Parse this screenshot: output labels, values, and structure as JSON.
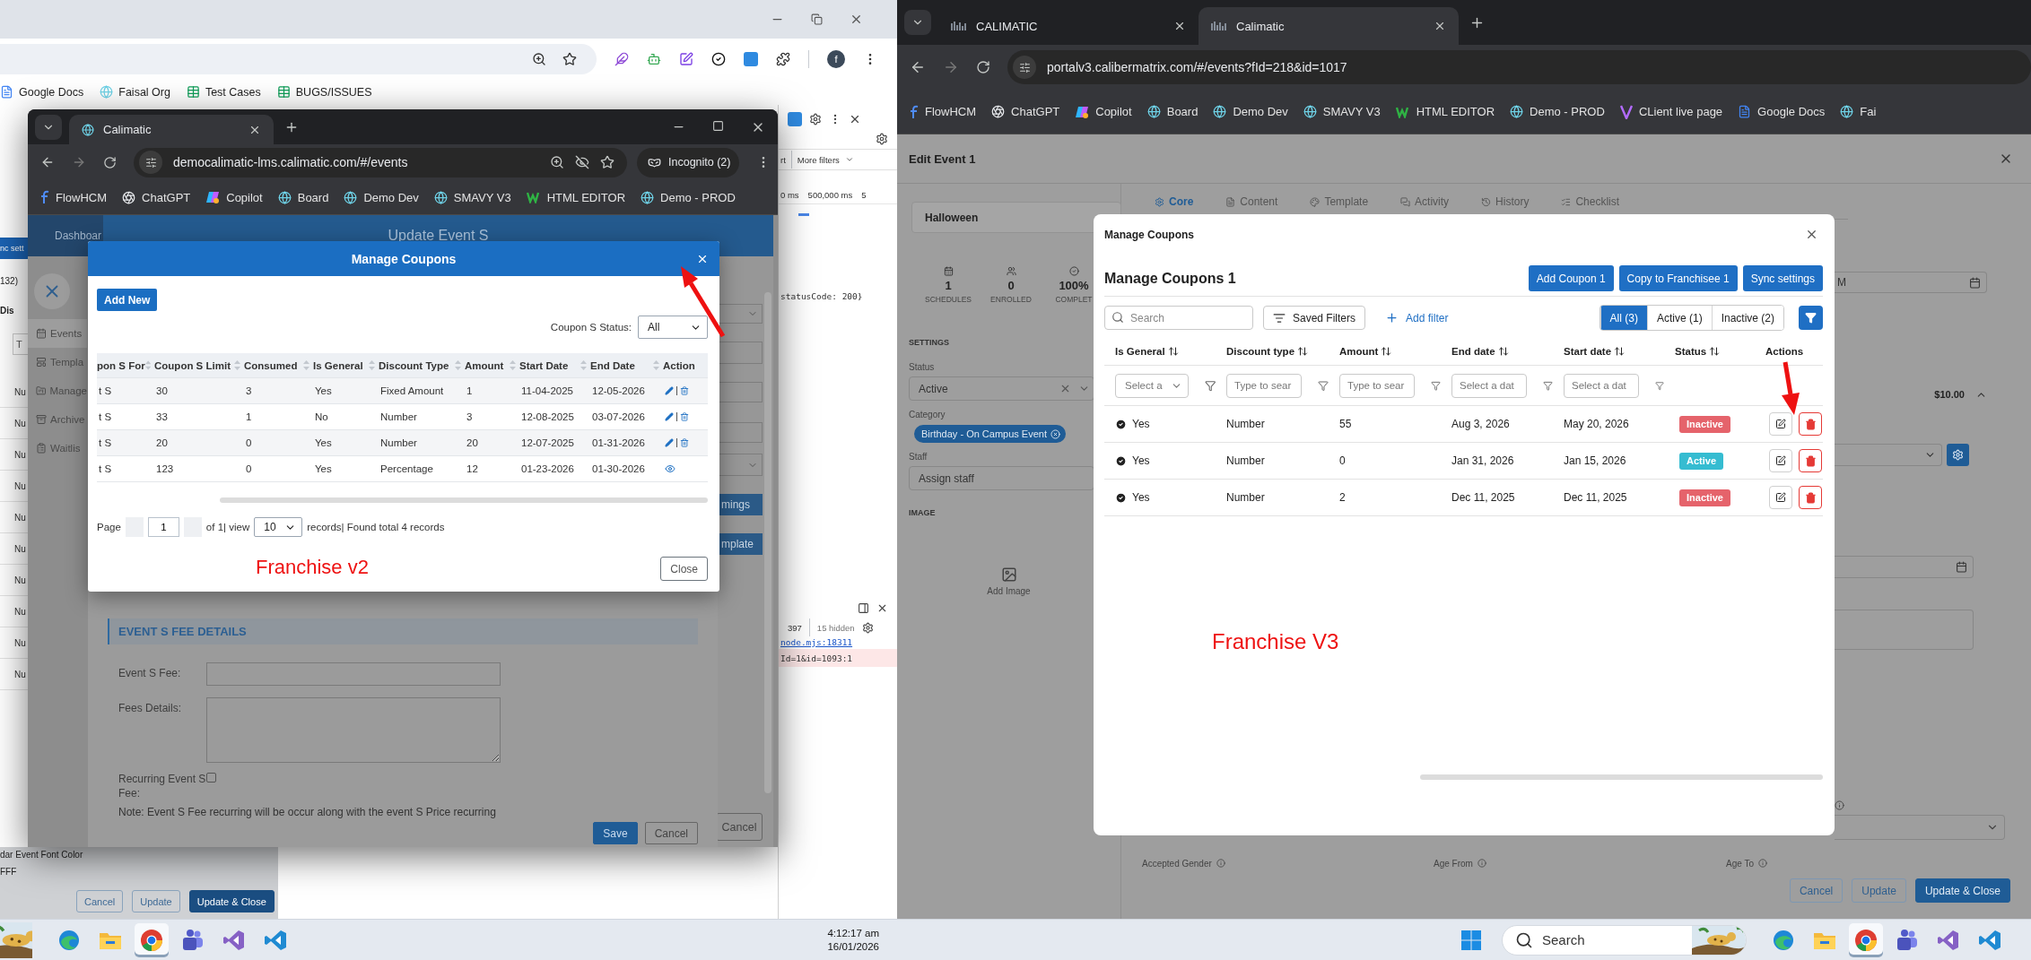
{
  "back_window": {
    "profile": "f",
    "bookmarks": [
      {
        "label": "Google Docs"
      },
      {
        "label": "Faisal Org"
      },
      {
        "label": "Test Cases"
      },
      {
        "label": "BUGS/ISSUES"
      }
    ],
    "page": {
      "sync_button": "nc sett",
      "count": "132)",
      "column": "Dis",
      "field_placeholder": "T",
      "cells": [
        "Nu",
        "Nu",
        "Nu",
        "Nu",
        "Nu",
        "Nu",
        "Nu",
        "Nu",
        "Nu",
        "Nu"
      ],
      "color_label": "dar Event Font Color",
      "color_value": "FFF",
      "buttons": [
        "Cancel",
        "Update",
        "Update & Close"
      ]
    },
    "devtools": {
      "tab": "rt",
      "filter": "More filters",
      "timeline": [
        "0 ms",
        "500,000 ms",
        "5"
      ],
      "console_line": "statusCode: 200}",
      "issue_count": "397",
      "hidden": "15 hidden",
      "source_link": "node.mjs:18311",
      "error_line": "Id=1&id=1093:1"
    }
  },
  "incognito_window": {
    "tab": "Calimatic",
    "url": "democalimatic-lms.calimatic.com/#/events",
    "incognito": "Incognito (2)",
    "bookmarks": [
      {
        "label": "FlowHCM"
      },
      {
        "label": "ChatGPT"
      },
      {
        "label": "Copilot"
      },
      {
        "label": "Board"
      },
      {
        "label": "Demo Dev"
      },
      {
        "label": "SMAVY V3"
      },
      {
        "label": "HTML EDITOR"
      },
      {
        "label": "Demo - PROD"
      }
    ],
    "page": {
      "nav": "Dashboar",
      "title": "Update Event S",
      "sidebar": [
        {
          "label": "Events",
          "selected": true
        },
        {
          "label": "Templa",
          "selected": false
        },
        {
          "label": "Manage",
          "selected": false
        },
        {
          "label": "Archive",
          "selected": false
        },
        {
          "label": "Waitlis",
          "selected": false
        }
      ],
      "side_buttons": [
        "mings",
        "mplate"
      ],
      "outer_cancel": "Cancel",
      "fee_section": {
        "title": "EVENT S FEE DETAILS",
        "fee_label": "Event S Fee:",
        "details_label": "Fees Details:",
        "recurring_label": "Recurring Event S Fee:",
        "recurring_checked": false,
        "note": "Note: Event S Fee recurring will be occur along with the event S Price recurring",
        "buttons": [
          "Save",
          "Cancel"
        ]
      }
    },
    "modal": {
      "title": "Manage Coupons",
      "add_button": "Add New",
      "status_label": "Coupon S Status:",
      "status_value": "All",
      "columns": [
        "pon S For",
        "Coupon S Limit",
        "Consumed",
        "Is General",
        "Discount Type",
        "Amount",
        "Start Date",
        "End Date",
        "Action"
      ],
      "rows": [
        {
          "kind": "edit_delete",
          "cells": [
            "t S",
            "30",
            "3",
            "Yes",
            "Fixed Amount",
            "1",
            "11-04-2025",
            "12-05-2026"
          ]
        },
        {
          "kind": "edit_delete",
          "cells": [
            "t S",
            "33",
            "1",
            "No",
            "Number",
            "3",
            "12-08-2025",
            "03-07-2026"
          ]
        },
        {
          "kind": "edit_delete",
          "cells": [
            "t S",
            "20",
            "0",
            "Yes",
            "Number",
            "20",
            "12-07-2025",
            "01-31-2026"
          ]
        },
        {
          "kind": "view",
          "cells": [
            "t S",
            "123",
            "0",
            "Yes",
            "Percentage",
            "12",
            "01-23-2026",
            "01-30-2026"
          ]
        }
      ],
      "pager": {
        "label": "Page",
        "page": "1",
        "of": "of 1| view",
        "per_page": "10",
        "summary": "records| Found total 4 records"
      },
      "close": "Close",
      "annotation": "Franchise v2"
    }
  },
  "right_window": {
    "tabs": [
      {
        "label": "CALIMATIC",
        "selected": false
      },
      {
        "label": "Calimatic",
        "selected": true
      }
    ],
    "url": "portalv3.calibermatrix.com/#/events?fId=218&id=1017",
    "bookmarks": [
      {
        "label": "FlowHCM"
      },
      {
        "label": "ChatGPT"
      },
      {
        "label": "Copilot"
      },
      {
        "label": "Board"
      },
      {
        "label": "Demo Dev"
      },
      {
        "label": "SMAVY V3"
      },
      {
        "label": "HTML EDITOR"
      },
      {
        "label": "Demo - PROD"
      },
      {
        "label": "CLient live page"
      },
      {
        "label": "Google Docs"
      },
      {
        "label": "Fai"
      }
    ],
    "page": {
      "title": "Edit Event 1",
      "tabs": [
        {
          "label": "Core",
          "selected": true
        },
        {
          "label": "Content",
          "selected": false
        },
        {
          "label": "Template",
          "selected": false
        },
        {
          "label": "Activity",
          "selected": false
        },
        {
          "label": "History",
          "selected": false
        },
        {
          "label": "Checklist",
          "selected": false
        }
      ],
      "event_name": "Halloween",
      "stats": [
        {
          "value": "1",
          "label": "SCHEDULES"
        },
        {
          "value": "0",
          "label": "ENROLLED"
        },
        {
          "value": "100%",
          "label": "COMPLET"
        }
      ],
      "settings_heading": "SETTINGS",
      "status_label": "Status",
      "status": "Active",
      "category_label": "Category",
      "category": "Birthday - On Campus Event",
      "staff_label": "Staff",
      "staff_placeholder": "Assign staff",
      "image_heading": "IMAGE",
      "add_image": "Add Image",
      "date_value": "M",
      "price": "$10.00",
      "labels": [
        "Accepted Gender",
        "Age From",
        "Age To"
      ],
      "buttons": [
        "Cancel",
        "Update",
        "Update & Close"
      ]
    },
    "modal": {
      "title": "Manage Coupons",
      "heading": "Manage Coupons 1",
      "actions": [
        "Add Coupon 1",
        "Copy to Franchisee 1",
        "Sync settings"
      ],
      "search_placeholder": "Search",
      "saved_filters": "Saved Filters",
      "add_filter": "Add filter",
      "segments": [
        {
          "label": "All (3)",
          "selected": true
        },
        {
          "label": "Active (1)",
          "selected": false
        },
        {
          "label": "Inactive (2)",
          "selected": false
        }
      ],
      "columns": [
        "Is General",
        "Discount type",
        "Amount",
        "End date",
        "Start date",
        "Status",
        "Actions"
      ],
      "filters": [
        {
          "kind": "select",
          "placeholder": "Select a"
        },
        {
          "kind": "text",
          "placeholder": "Type to sear"
        },
        {
          "kind": "text",
          "placeholder": "Type to sear"
        },
        {
          "kind": "date",
          "placeholder": "Select a dat"
        },
        {
          "kind": "date",
          "placeholder": "Select a dat"
        }
      ],
      "rows": [
        {
          "general": "Yes",
          "discount_type": "Number",
          "amount": "55",
          "end_date": "Aug 3, 2026",
          "start_date": "May 20, 2026",
          "status": "Inactive",
          "color": "#e5636b"
        },
        {
          "general": "Yes",
          "discount_type": "Number",
          "amount": "0",
          "end_date": "Jan 31, 2026",
          "start_date": "Jan 15, 2026",
          "status": "Active",
          "color": "#35bcd1"
        },
        {
          "general": "Yes",
          "discount_type": "Number",
          "amount": "2",
          "end_date": "Dec 11, 2025",
          "start_date": "Dec 11, 2025",
          "status": "Inactive",
          "color": "#e5636b"
        }
      ],
      "annotation": "Franchise V3"
    }
  },
  "taskbar": {
    "left_apps": [
      {
        "active": false
      },
      {
        "active": false
      },
      {
        "active": true
      },
      {
        "active": false
      },
      {
        "active": false
      },
      {
        "active": false
      }
    ],
    "right_apps": [
      {
        "active": false
      },
      {
        "active": false
      },
      {
        "active": true
      },
      {
        "active": false
      },
      {
        "active": false
      },
      {
        "active": false
      }
    ],
    "search": "Search",
    "time": "4:12:17 am",
    "date": "16/01/2026"
  }
}
